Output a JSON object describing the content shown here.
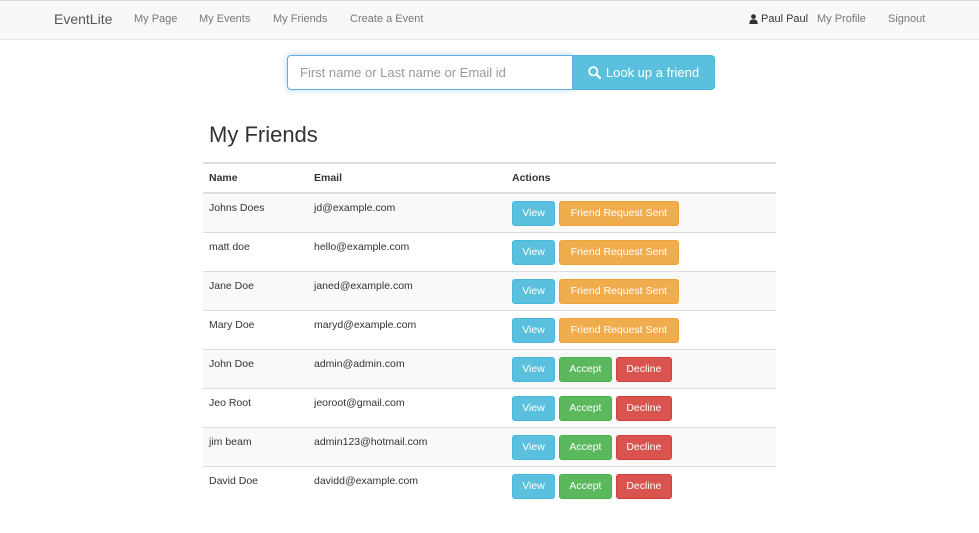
{
  "navbar": {
    "brand": "EventLite",
    "links": [
      "My Page",
      "My Events",
      "My Friends",
      "Create a Event"
    ],
    "user_name": "Paul Paul",
    "profile": "My Profile",
    "signout": "Signout",
    "user_icon": "user-icon"
  },
  "search": {
    "placeholder": "First name or Last name or Email id",
    "button_label": "Look up a friend",
    "button_icon": "search-icon"
  },
  "page_title": "My Friends",
  "table": {
    "headers": [
      "Name",
      "Email",
      "Actions"
    ],
    "rows": [
      {
        "name": "Johns Does",
        "email": "jd@example.com",
        "actions": [
          "View",
          "Friend Request Sent"
        ]
      },
      {
        "name": "matt doe",
        "email": "hello@example.com",
        "actions": [
          "View",
          "Friend Request Sent"
        ]
      },
      {
        "name": "Jane Doe",
        "email": "janed@example.com",
        "actions": [
          "View",
          "Friend Request Sent"
        ]
      },
      {
        "name": "Mary Doe",
        "email": "maryd@example.com",
        "actions": [
          "View",
          "Friend Request Sent"
        ]
      },
      {
        "name": "John Doe",
        "email": "admin@admin.com",
        "actions": [
          "View",
          "Accept",
          "Decline"
        ]
      },
      {
        "name": "Jeo Root",
        "email": "jeoroot@gmail.com",
        "actions": [
          "View",
          "Accept",
          "Decline"
        ]
      },
      {
        "name": "jim beam",
        "email": "admin123@hotmail.com",
        "actions": [
          "View",
          "Accept",
          "Decline"
        ]
      },
      {
        "name": "David Doe",
        "email": "davidd@example.com",
        "actions": [
          "View",
          "Accept",
          "Decline"
        ]
      }
    ]
  },
  "colors": {
    "info": "#5bc0de",
    "warning": "#f0ad4e",
    "success": "#5cb85c",
    "danger": "#d9534f"
  }
}
